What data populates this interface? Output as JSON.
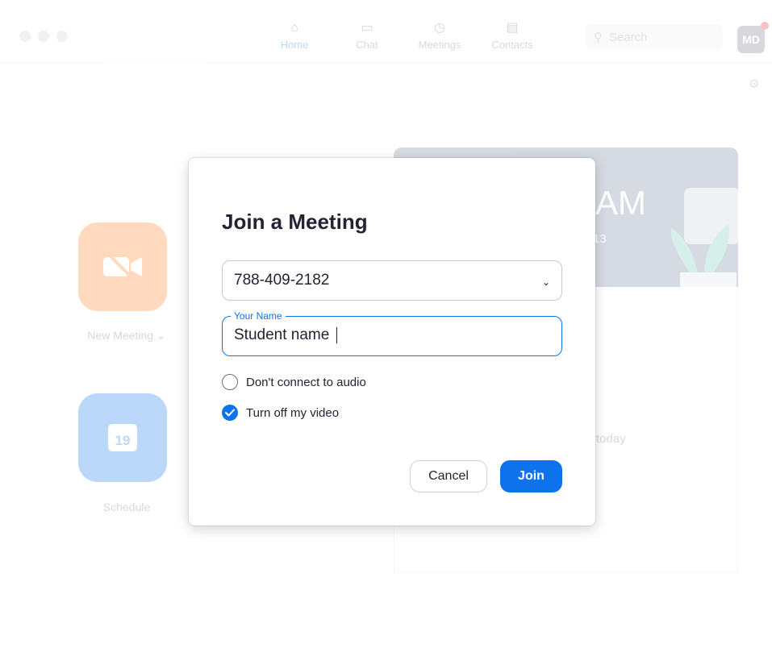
{
  "app": {
    "nav": [
      {
        "label": "Home",
        "icon": "home-icon"
      },
      {
        "label": "Chat",
        "icon": "chat-icon"
      },
      {
        "label": "Meetings",
        "icon": "clock-icon"
      },
      {
        "label": "Contacts",
        "icon": "contacts-icon"
      }
    ],
    "search_placeholder": "Search",
    "avatar_initials": "MD",
    "new_meeting_label": "New Meeting",
    "schedule_label": "Schedule",
    "calendar_day": "19",
    "hero_time": "AM",
    "hero_date": "13",
    "no_meetings_text": "gs today"
  },
  "modal": {
    "title": "Join a Meeting",
    "meeting_id": "788-409-2182",
    "name_legend": "Your Name",
    "name_value": "Student name",
    "options": {
      "audio_label": "Don't connect to audio",
      "audio_checked": false,
      "video_label": "Turn off my video",
      "video_checked": true
    },
    "cancel_label": "Cancel",
    "join_label": "Join"
  },
  "colors": {
    "accent": "#0e72ed",
    "text": "#232333",
    "orange": "#ff7a1a"
  }
}
